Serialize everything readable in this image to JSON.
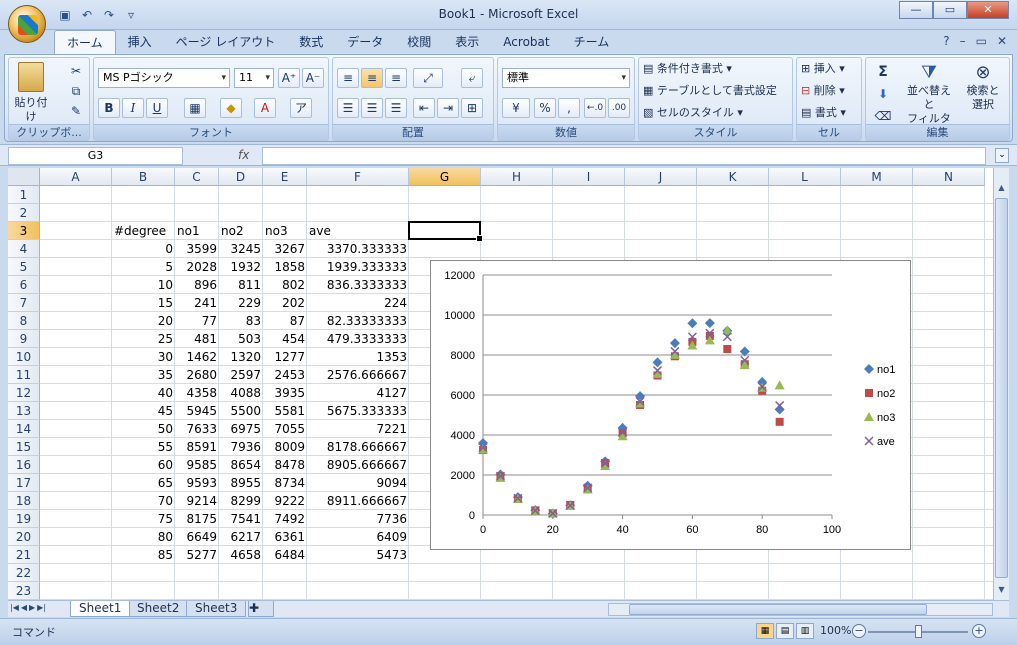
{
  "window": {
    "title": "Book1 - Microsoft Excel"
  },
  "ribbon_tabs": [
    "ホーム",
    "挿入",
    "ページ レイアウト",
    "数式",
    "データ",
    "校閲",
    "表示",
    "Acrobat",
    "チーム"
  ],
  "groups": {
    "clipboard": {
      "label": "クリップボ...",
      "paste": "貼り付け"
    },
    "font": {
      "label": "フォント",
      "font_name": "MS Pゴシック",
      "font_size": "11"
    },
    "alignment": {
      "label": "配置"
    },
    "number": {
      "label": "数値",
      "format": "標準"
    },
    "style": {
      "label": "スタイル",
      "cond": "条件付き書式",
      "table": "テーブルとして書式設定",
      "cellstyle": "セルのスタイル"
    },
    "cells": {
      "label": "セル",
      "insert": "挿入",
      "delete": "削除",
      "format": "書式"
    },
    "editing": {
      "label": "編集",
      "sort": "並べ替えと",
      "sort2": "フィルタ",
      "find": "検索と",
      "find2": "選択"
    }
  },
  "formula_bar": {
    "name_box": "G3",
    "fx": "fx",
    "content": ""
  },
  "columns": [
    "A",
    "B",
    "C",
    "D",
    "E",
    "F",
    "G",
    "H",
    "I",
    "J",
    "K",
    "L",
    "M",
    "N"
  ],
  "rows": [
    "1",
    "2",
    "3",
    "4",
    "5",
    "6",
    "7",
    "8",
    "9",
    "10",
    "11",
    "12",
    "13",
    "14",
    "15",
    "16",
    "17",
    "18",
    "19",
    "20",
    "21",
    "22",
    "23"
  ],
  "headers": [
    "#degree",
    "no1",
    "no2",
    "no3",
    "ave"
  ],
  "table": [
    [
      "0",
      "3599",
      "3245",
      "3267",
      "3370.333333"
    ],
    [
      "5",
      "2028",
      "1932",
      "1858",
      "1939.333333"
    ],
    [
      "10",
      "896",
      "811",
      "802",
      "836.3333333"
    ],
    [
      "15",
      "241",
      "229",
      "202",
      "224"
    ],
    [
      "20",
      "77",
      "83",
      "87",
      "82.33333333"
    ],
    [
      "25",
      "481",
      "503",
      "454",
      "479.3333333"
    ],
    [
      "30",
      "1462",
      "1320",
      "1277",
      "1353"
    ],
    [
      "35",
      "2680",
      "2597",
      "2453",
      "2576.666667"
    ],
    [
      "40",
      "4358",
      "4088",
      "3935",
      "4127"
    ],
    [
      "45",
      "5945",
      "5500",
      "5581",
      "5675.333333"
    ],
    [
      "50",
      "7633",
      "6975",
      "7055",
      "7221"
    ],
    [
      "55",
      "8591",
      "7936",
      "8009",
      "8178.666667"
    ],
    [
      "60",
      "9585",
      "8654",
      "8478",
      "8905.666667"
    ],
    [
      "65",
      "9593",
      "8955",
      "8734",
      "9094"
    ],
    [
      "70",
      "9214",
      "8299",
      "9222",
      "8911.666667"
    ],
    [
      "75",
      "8175",
      "7541",
      "7492",
      "7736"
    ],
    [
      "80",
      "6649",
      "6217",
      "6361",
      "6409"
    ],
    [
      "85",
      "5277",
      "4658",
      "6484",
      "5473"
    ]
  ],
  "chart_data": {
    "type": "scatter",
    "x": [
      0,
      5,
      10,
      15,
      20,
      25,
      30,
      35,
      40,
      45,
      50,
      55,
      60,
      65,
      70,
      75,
      80,
      85
    ],
    "series": [
      {
        "name": "no1",
        "color": "#4a7ebb",
        "marker": "diamond",
        "values": [
          3599,
          2028,
          896,
          241,
          77,
          481,
          1462,
          2680,
          4358,
          5945,
          7633,
          8591,
          9585,
          9593,
          9214,
          8175,
          6649,
          5277
        ]
      },
      {
        "name": "no2",
        "color": "#be4b48",
        "marker": "square",
        "values": [
          3245,
          1932,
          811,
          229,
          83,
          503,
          1320,
          2597,
          4088,
          5500,
          6975,
          7936,
          8654,
          8955,
          8299,
          7541,
          6217,
          4658
        ]
      },
      {
        "name": "no3",
        "color": "#98b954",
        "marker": "triangle",
        "values": [
          3267,
          1858,
          802,
          202,
          87,
          454,
          1277,
          2453,
          3935,
          5581,
          7055,
          8009,
          8478,
          8734,
          9222,
          7492,
          6361,
          6484
        ]
      },
      {
        "name": "ave",
        "color": "#7d60a0",
        "marker": "x",
        "values": [
          3370.333333,
          1939.333333,
          836.3333333,
          224,
          82.33333333,
          479.3333333,
          1353,
          2576.666667,
          4127,
          5675.333333,
          7221,
          8178.666667,
          8905.666667,
          9094,
          8911.666667,
          7736,
          6409,
          5473
        ]
      }
    ],
    "xlim": [
      0,
      100
    ],
    "ylim": [
      0,
      12000
    ],
    "xticks": [
      "0",
      "20",
      "40",
      "60",
      "80",
      "100"
    ],
    "yticks": [
      "0",
      "2000",
      "4000",
      "6000",
      "8000",
      "10000",
      "12000"
    ],
    "grid": true,
    "legend": "right"
  },
  "sheets": [
    "Sheet1",
    "Sheet2",
    "Sheet3"
  ],
  "status": {
    "mode": "コマンド",
    "zoom": "100%"
  }
}
